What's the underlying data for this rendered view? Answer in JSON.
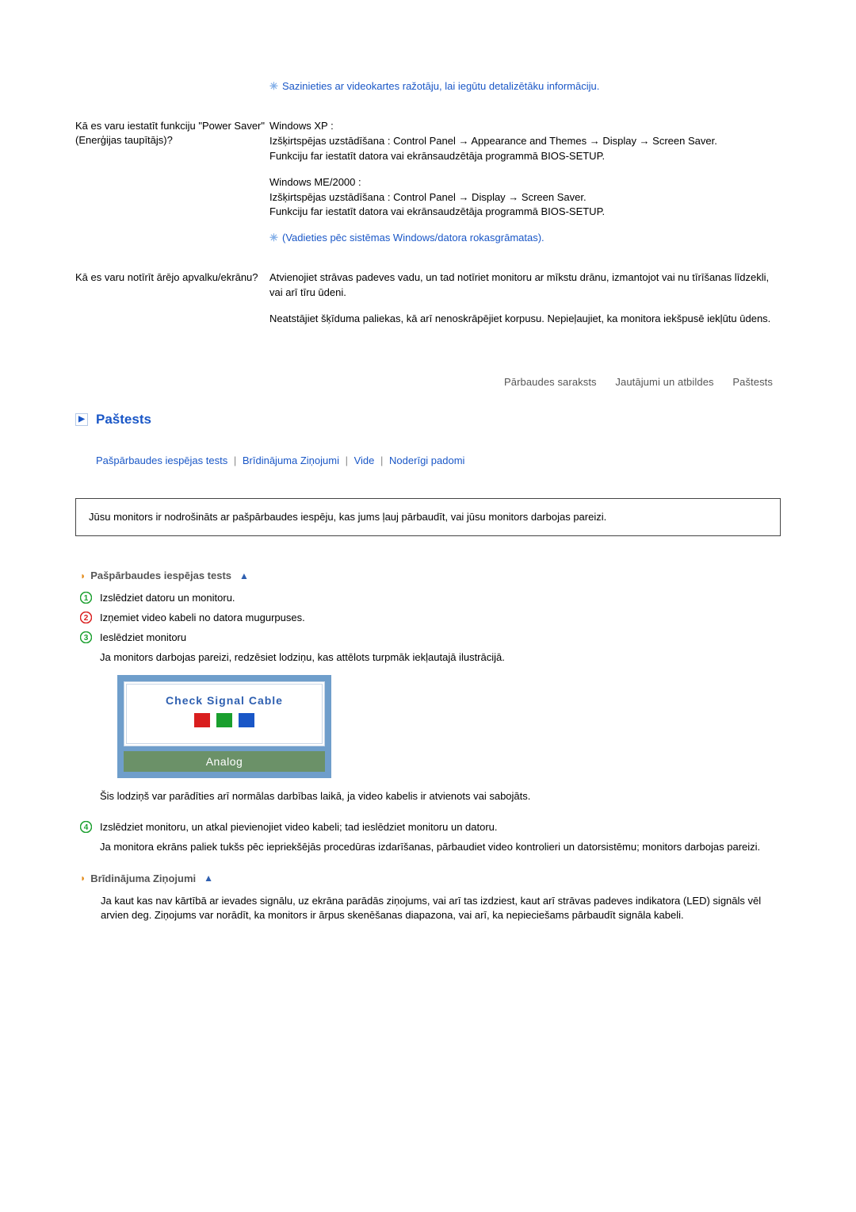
{
  "qna": {
    "q1": {
      "question": "",
      "note1": "Sazinieties ar videokartes ražotāju, lai iegūtu detalizētāku informāciju."
    },
    "q2": {
      "question": "Kā es varu iestatīt funkciju \"Power Saver\" (Enerģijas taupītājs)?",
      "ans1": "Windows XP :\nIzšķirtspējas uzstādīšana : Control Panel → Appearance and Themes → Display → Screen Saver.\nFunkciju far iestatīt datora vai ekrānsaudzētāja programmā BIOS-SETUP.",
      "ans2": "Windows ME/2000 :\nIzšķirtspējas uzstādīšana : Control Panel → Display → Screen Saver.\nFunkciju far iestatīt datora vai ekrānsaudzētāja programmā BIOS-SETUP.",
      "note": "(Vadieties pēc sistēmas Windows/datora rokasgrāmatas)."
    },
    "q3": {
      "question": "Kā es varu notīrīt ārējo apvalku/ekrānu?",
      "ans1": "Atvienojiet strāvas padeves vadu, un tad notīriet monitoru ar mīkstu drānu, izmantojot vai nu tīrīšanas līdzekli, vai arī tīru ūdeni.",
      "ans2": "Neatstājiet šķīduma paliekas, kā arī nenoskrāpējiet korpusu. Nepieļaujiet, ka monitora iekšpusē iekļūtu ūdens."
    }
  },
  "top_links": {
    "a": "Pārbaudes saraksts",
    "b": "Jautājumi un atbildes",
    "c": "Paštests"
  },
  "section_title": "Paštests",
  "tabs": {
    "a": "Pašpārbaudes iespējas tests",
    "b": "Brīdinājuma Ziņojumi",
    "c": "Vide",
    "d": "Noderīgi padomi"
  },
  "intro": "Jūsu monitors ir nodrošināts ar pašpārbaudes iespēju, kas jums ļauj pārbaudīt, vai jūsu monitors darbojas pareizi.",
  "sub1": {
    "title": "Pašpārbaudes iespējas tests",
    "steps": {
      "s1": "Izslēdziet datoru un monitoru.",
      "s2": "Izņemiet video kabeli no datora mugurpuses.",
      "s3": "Ieslēdziet monitoru",
      "s3b": "Ja monitors darbojas pareizi, redzēsiet lodziņu, kas attēlots turpmāk iekļautajā ilustrācijā.",
      "s3_after": "Šis lodziņš var parādīties arī normālas darbības laikā, ja video kabelis ir atvienots vai sabojāts.",
      "s4": "Izslēdziet monitoru, un atkal pievienojiet video kabeli; tad ieslēdziet monitoru un datoru.",
      "s4b": "Ja monitora ekrāns paliek tukšs pēc iepriekšējās procedūras izdarīšanas, pārbaudiet video kontrolieri un datorsistēmu; monitors darbojas pareizi."
    },
    "csc": {
      "title": "Check Signal Cable",
      "mode": "Analog"
    }
  },
  "sub2": {
    "title": "Brīdinājuma Ziņojumi",
    "body": "Ja kaut kas nav kārtībā ar ievades signālu, uz ekrāna parādās ziņojums, vai arī tas izdziest, kaut arī strāvas padeves indikatora (LED) signāls vēl arvien deg. Ziņojums var norādīt, ka monitors ir ārpus skenēšanas diapazona, vai arī, ka nepieciešams pārbaudīt signāla kabeli."
  }
}
